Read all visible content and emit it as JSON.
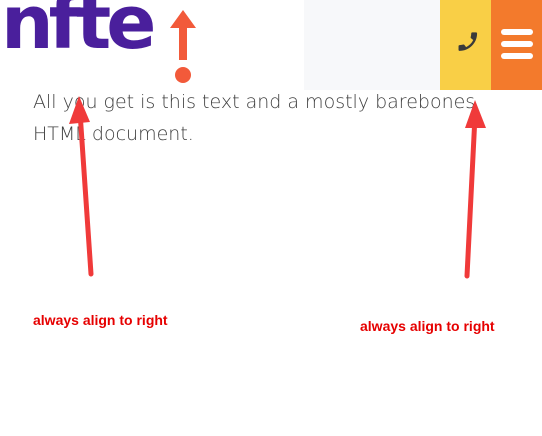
{
  "header": {
    "logo_text": "nfte",
    "logo_colors": {
      "wordmark": "#4a1f9c",
      "mark": "#f25a3a"
    },
    "phone_button": {
      "icon": "phone-icon",
      "color": "#f9cf46"
    },
    "menu_button": {
      "icon": "hamburger-menu-icon",
      "color": "#f37a2c"
    }
  },
  "content": {
    "body_text": "All you get is this text and a mostly barebones HTML document."
  },
  "annotations": {
    "left_label": "always align to right",
    "right_label": "always align to right",
    "color": "#e60000"
  }
}
